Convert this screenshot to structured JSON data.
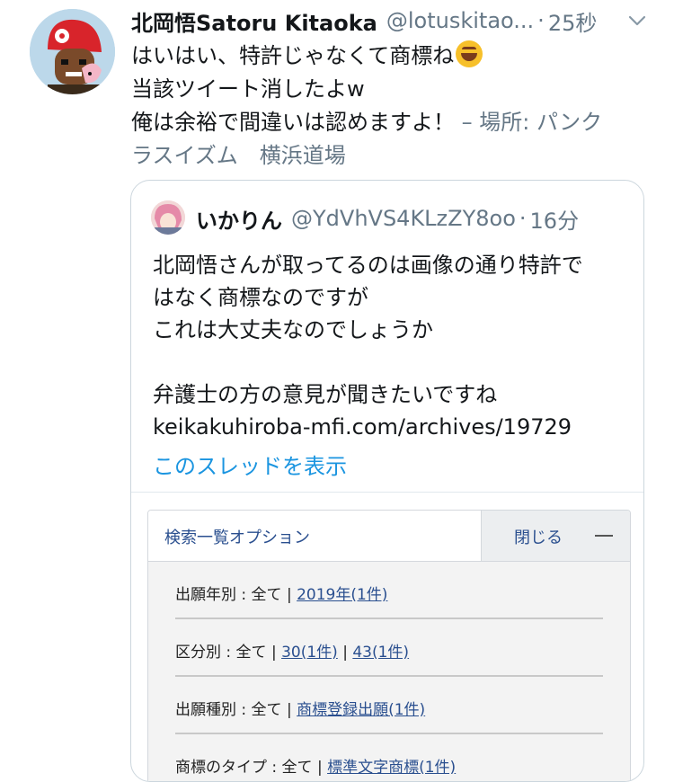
{
  "tweet": {
    "author_name": "北岡悟Satoru Kitaoka",
    "author_handle": "@lotuskitao...",
    "separator": "·",
    "time": "25秒",
    "text_lines": [
      "はいはい、特許じゃなくて商標ね",
      "当該ツイート消したよw",
      "俺は余裕で間違いは認めますよ！"
    ],
    "place_label": "– 場所: パンク",
    "place_continued": "ラスイズム　横浜道場",
    "icons": {
      "menu": "chevron-down-icon",
      "emoji": "rofl-emoji"
    }
  },
  "quote": {
    "author_name": "いかりん",
    "author_handle": "@YdVhVS4KLzZY8oo",
    "separator": "·",
    "time": "16分",
    "text_lines": [
      "北岡悟さんが取ってるのは画像の通り特許で",
      "はなく商標なのですが",
      "これは大丈夫なのでしょうか",
      "",
      "弁護士の方の意見が聞きたいですね",
      "keikakuhiroba-mfi.com/archives/19729"
    ],
    "show_thread": "このスレッドを表示"
  },
  "search_panel": {
    "title": "検索一覧オプション",
    "close_label": "閉じる",
    "rows": [
      {
        "prefix": "出願年別 : 全て | ",
        "links": [
          "2019年(1件)"
        ]
      },
      {
        "prefix": "区分別 : 全て | ",
        "links": [
          "30(1件)",
          "43(1件)"
        ]
      },
      {
        "prefix": "出願種別 : 全て | ",
        "links": [
          "商標登録出願(1件)"
        ]
      },
      {
        "prefix": "商標のタイプ : 全て | ",
        "links": [
          "標準文字商標(1件)"
        ]
      }
    ],
    "link_color": "#2a4f8f"
  },
  "colors": {
    "text": "#14171a",
    "secondary": "#657786",
    "link": "#1b95e0"
  }
}
